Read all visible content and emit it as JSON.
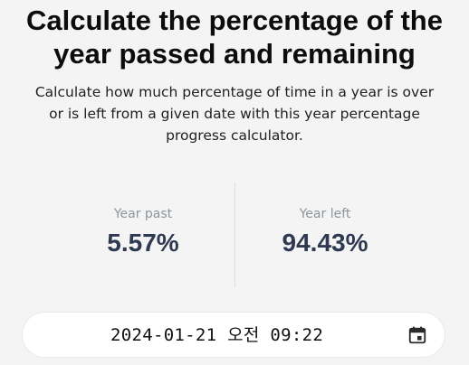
{
  "header": {
    "title_line1": "Calculate the percentage of the",
    "title_line2": "year passed and remaining",
    "description_line1": "Calculate how much percentage of time in a year is over",
    "description_line2": "or is left from a given date with this year percentage",
    "description_line3": "progress calculator."
  },
  "stats": {
    "past": {
      "label": "Year past",
      "value": "5.57%"
    },
    "left": {
      "label": "Year left",
      "value": "94.43%"
    }
  },
  "date_input": {
    "value": "2024-01-21 오전 09:22",
    "icon": "calendar-icon"
  },
  "colors": {
    "background": "#f4f4f4",
    "value_text": "#2f3a52",
    "label_text": "#8d949b"
  }
}
